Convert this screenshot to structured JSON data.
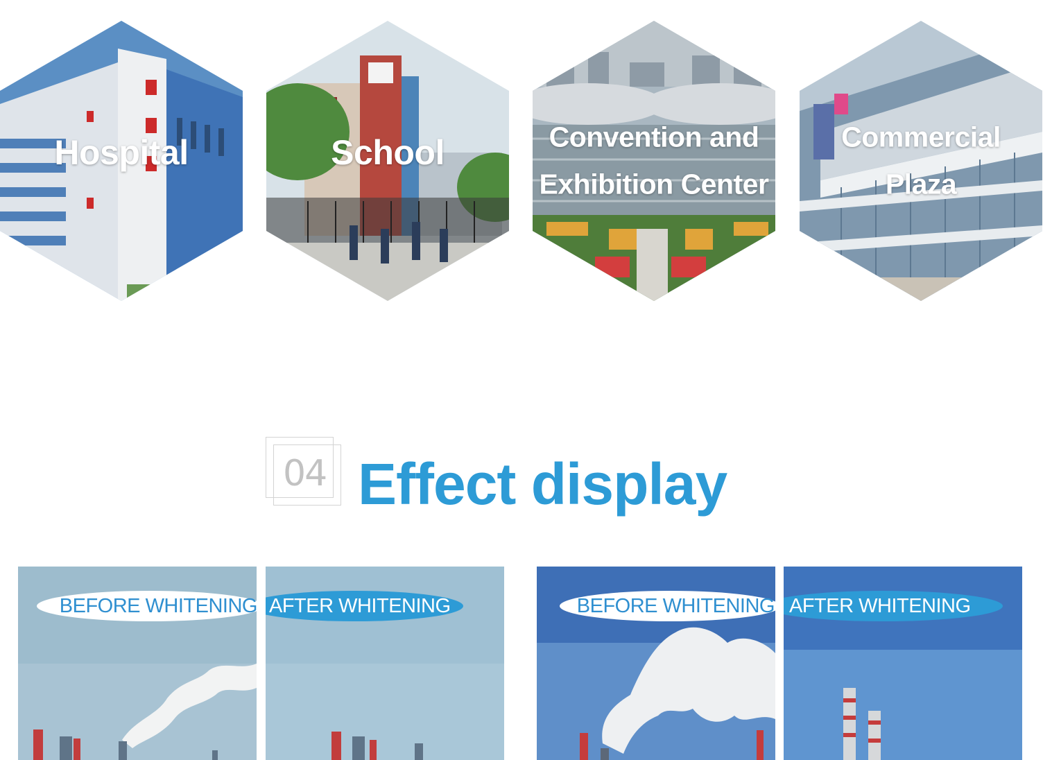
{
  "applications": [
    {
      "label_lines": [
        "Hospital"
      ],
      "icon": "hospital-building-photo"
    },
    {
      "label_lines": [
        "School"
      ],
      "icon": "school-gate-photo"
    },
    {
      "label_lines": [
        "Convention and",
        "Exhibition Center"
      ],
      "icon": "convention-center-photo"
    },
    {
      "label_lines": [
        "Commercial",
        "Plaza"
      ],
      "icon": "shopping-plaza-photo"
    }
  ],
  "section": {
    "number": "04",
    "title": "Effect display"
  },
  "comparisons": [
    {
      "before_label": "BEFORE WHITENING",
      "after_label": "AFTER WHITENING"
    },
    {
      "before_label": "BEFORE WHITENING",
      "after_label": "AFTER WHITENING"
    }
  ],
  "colors": {
    "accent": "#2d9bd6",
    "section_number": "#c2c2c2"
  }
}
